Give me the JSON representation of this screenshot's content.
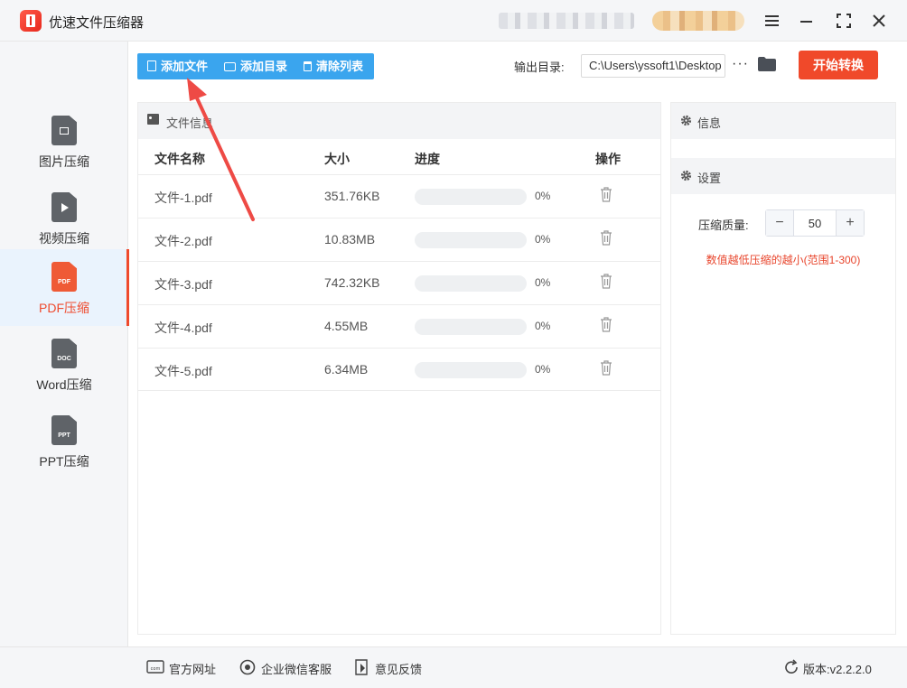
{
  "app": {
    "title": "优速文件压缩器"
  },
  "sidebar": {
    "items": [
      {
        "label": "图片压缩",
        "icon": "image-file-icon"
      },
      {
        "label": "视频压缩",
        "icon": "video-file-icon"
      },
      {
        "label": "PDF压缩",
        "icon": "pdf-file-icon",
        "badge": "PDF",
        "active": true
      },
      {
        "label": "Word压缩",
        "icon": "doc-file-icon",
        "badge": "DOC"
      },
      {
        "label": "PPT压缩",
        "icon": "ppt-file-icon",
        "badge": "PPT"
      }
    ]
  },
  "toolbar": {
    "add_file": "添加文件",
    "add_dir": "添加目录",
    "clear_list": "清除列表",
    "output_label": "输出目录:",
    "output_path": "C:\\Users\\yssoft1\\Desktop",
    "more": "···",
    "start": "开始转换"
  },
  "file_panel": {
    "title": "文件信息",
    "columns": {
      "name": "文件名称",
      "size": "大小",
      "progress": "进度",
      "action": "操作"
    },
    "rows": [
      {
        "name": "文件-1.pdf",
        "size": "351.76KB",
        "progress": 0,
        "progress_text": "0%"
      },
      {
        "name": "文件-2.pdf",
        "size": "10.83MB",
        "progress": 0,
        "progress_text": "0%"
      },
      {
        "name": "文件-3.pdf",
        "size": "742.32KB",
        "progress": 0,
        "progress_text": "0%"
      },
      {
        "name": "文件-4.pdf",
        "size": "4.55MB",
        "progress": 0,
        "progress_text": "0%"
      },
      {
        "name": "文件-5.pdf",
        "size": "6.34MB",
        "progress": 0,
        "progress_text": "0%"
      }
    ]
  },
  "right_panel": {
    "info_title": "信息",
    "settings_title": "设置",
    "quality_label": "压缩质量:",
    "quality_value": "50",
    "minus": "−",
    "plus": "+",
    "hint": "数值越低压缩的越小(范围1-300)"
  },
  "footer": {
    "website": "官方网址",
    "wechat": "企业微信客服",
    "feedback": "意见反馈",
    "version": "版本:v2.2.2.0"
  },
  "colors": {
    "accent_blue": "#3aa5ee",
    "accent_red": "#f0492a"
  }
}
